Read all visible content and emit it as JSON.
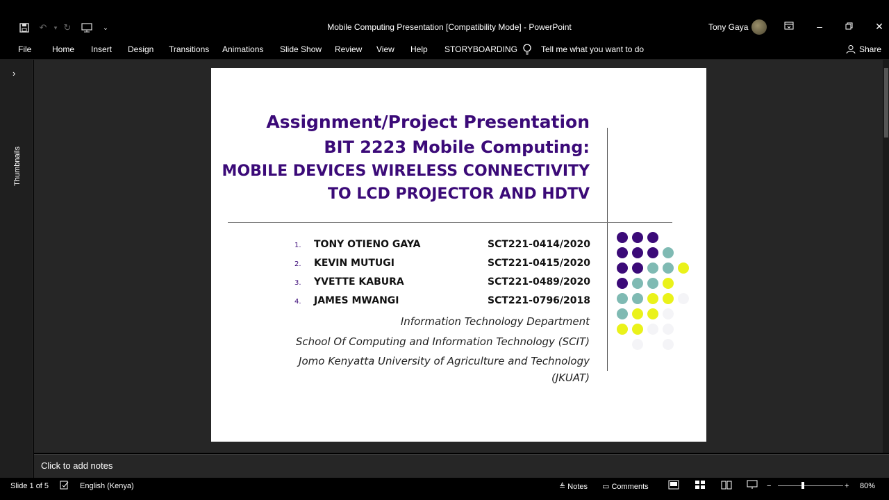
{
  "window": {
    "title": "Mobile Computing Presentation [Compatibility Mode]  -  PowerPoint",
    "user": "Tony Gaya",
    "controls": [
      "ribbon-display",
      "minimize",
      "restore",
      "close"
    ]
  },
  "quick_access": [
    "save-icon",
    "undo-icon",
    "redo-icon",
    "present-icon",
    "customize-icon"
  ],
  "ribbon": {
    "tabs": [
      "File",
      "Home",
      "Insert",
      "Design",
      "Transitions",
      "Animations",
      "Slide Show",
      "Review",
      "View",
      "Help",
      "STORYBOARDING"
    ],
    "tell_me": "Tell me what you want to do",
    "share": "Share"
  },
  "thumbnails": {
    "label": "Thumbnails"
  },
  "slide": {
    "title_line1": "Assignment/Project Presentation",
    "title_line2": "BIT 2223 Mobile Computing:",
    "title_line3": "MOBILE DEVICES WIRELESS CONNECTIVITY",
    "title_line4": "TO LCD PROJECTOR AND HDTV",
    "members": [
      {
        "num": "1.",
        "name": "TONY OTIENO GAYA",
        "id": "SCT221-0414/2020"
      },
      {
        "num": "2.",
        "name": "KEVIN MUTUGI",
        "id": "SCT221-0415/2020"
      },
      {
        "num": "3.",
        "name": "YVETTE KABURA",
        "id": "SCT221-0489/2020"
      },
      {
        "num": "4.",
        "name": "JAMES MWANGI",
        "id": "SCT221-0796/2018"
      }
    ],
    "department": "Information Technology Department",
    "school": "School Of Computing and Information Technology (SCIT)",
    "university_line1": "Jomo Kenyatta University of Agriculture and Technology",
    "university_line2": "(JKUAT)",
    "colors": {
      "purple": "#3b0a78",
      "teal": "#7fbab3",
      "yellow": "#eaf21a"
    }
  },
  "notes": {
    "placeholder": "Click to add notes"
  },
  "status": {
    "slide": "Slide 1 of 5",
    "language": "English (Kenya)",
    "notes": "Notes",
    "comments": "Comments",
    "zoom": "80%"
  }
}
